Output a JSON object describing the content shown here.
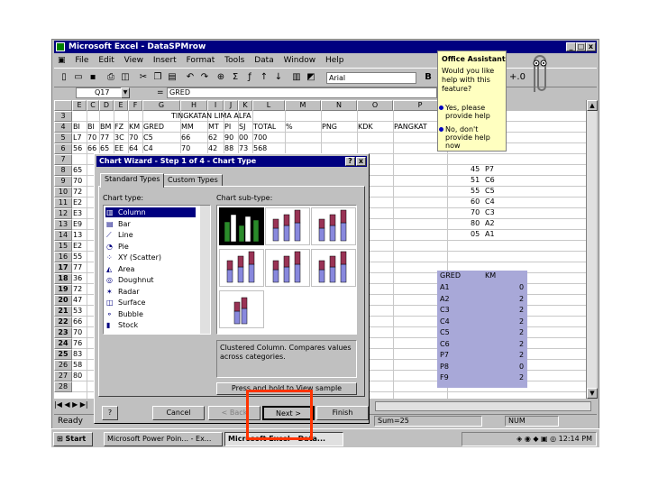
{
  "window": {
    "title": "Microsoft Excel - DataSPMrow",
    "menu": [
      "File",
      "Edit",
      "View",
      "Insert",
      "Format",
      "Tools",
      "Data",
      "Window",
      "Help"
    ]
  },
  "toolbar": {
    "font_name": "Arial",
    "bold": "B",
    "zoom_pct": "+.0"
  },
  "formula_bar": {
    "name_box": "Q17",
    "equals": "=",
    "content": "GRED"
  },
  "columns": [
    "E",
    "C",
    "D",
    "E",
    "F",
    "G",
    "H",
    "I",
    "J",
    "K",
    "L",
    "M",
    "N",
    "O",
    "P"
  ],
  "rows": [
    "3",
    "4",
    "5",
    "6",
    "7",
    "8",
    "9",
    "10",
    "11",
    "12",
    "13",
    "14",
    "15",
    "16",
    "17",
    "18",
    "19",
    "20",
    "21",
    "22",
    "23",
    "24",
    "25",
    "26",
    "27",
    "28"
  ],
  "sheet": {
    "banner": "TINGKATAN LIMA ALFA",
    "headers": [
      "BI",
      "BI",
      "BM",
      "FZ",
      "KM",
      "GRED",
      "MM",
      "MT",
      "PI",
      "SJ",
      "TOTAL",
      "%",
      "PNG",
      "KDK",
      "PANGKAT"
    ],
    "row5": [
      "L7",
      "70",
      "77",
      "3C",
      "70",
      "C5",
      "66",
      "62",
      "90",
      "00",
      "700"
    ],
    "row6": [
      "56",
      "66",
      "65",
      "EE",
      "64",
      "C4",
      "70",
      "42",
      "88",
      "73",
      "568"
    ],
    "col_a": [
      "L7",
      "56",
      "65",
      "70",
      "72",
      "E2",
      "E3",
      "E9",
      "13",
      "E2",
      "55",
      "77",
      "36",
      "72",
      "47",
      "53",
      "66",
      "70",
      "76",
      "83",
      "58",
      "80"
    ],
    "right_list": [
      {
        "v": "45",
        "g": "P7"
      },
      {
        "v": "51",
        "g": "C6"
      },
      {
        "v": "55",
        "g": "C5"
      },
      {
        "v": "60",
        "g": "C4"
      },
      {
        "v": "70",
        "g": "C3"
      },
      {
        "v": "80",
        "g": "A2"
      },
      {
        "v": "05",
        "g": "A1"
      }
    ],
    "table_header": [
      "GRED",
      "KM"
    ],
    "table_rows": [
      {
        "g": "A1",
        "n": "0"
      },
      {
        "g": "A2",
        "n": "2"
      },
      {
        "g": "C3",
        "n": "2"
      },
      {
        "g": "C4",
        "n": "2"
      },
      {
        "g": "C5",
        "n": "2"
      },
      {
        "g": "C6",
        "n": "2"
      },
      {
        "g": "P7",
        "n": "2"
      },
      {
        "g": "P8",
        "n": "0"
      },
      {
        "g": "F9",
        "n": "2"
      }
    ]
  },
  "status": {
    "ready": "Ready",
    "sum": "Sum=25",
    "num": "NUM"
  },
  "taskbar": {
    "start": "Start",
    "task1": "Microsoft Power Poin... - Ex...",
    "task2": "Microsoft Excel - Data...",
    "clock": "12:14 PM"
  },
  "assistant": {
    "title": "Office Assistant",
    "question": "Would you like help with this feature?",
    "option1": "Yes, please provide help",
    "option2": "No, don't provide help now"
  },
  "dialog": {
    "title": "Chart Wizard - Step 1 of 4 - Chart Type",
    "tab_standard": "Standard Types",
    "tab_custom": "Custom Types",
    "chart_type_label": "Chart type:",
    "subtype_label": "Chart sub-type:",
    "chart_types": [
      "Column",
      "Bar",
      "Line",
      "Pie",
      "XY (Scatter)",
      "Area",
      "Doughnut",
      "Radar",
      "Surface",
      "Bubble",
      "Stock"
    ],
    "description": "Clustered Column. Compares values across categories.",
    "press_hold": "Press and hold to View sample",
    "help": "?",
    "cancel": "Cancel",
    "back": "< Back",
    "next": "Next >",
    "finish": "Finish",
    "question_mark": "?",
    "close": "x"
  },
  "colors": {
    "highlight": "#ff3300",
    "selection": "#a8a8d8",
    "titlebar": "#000080"
  }
}
